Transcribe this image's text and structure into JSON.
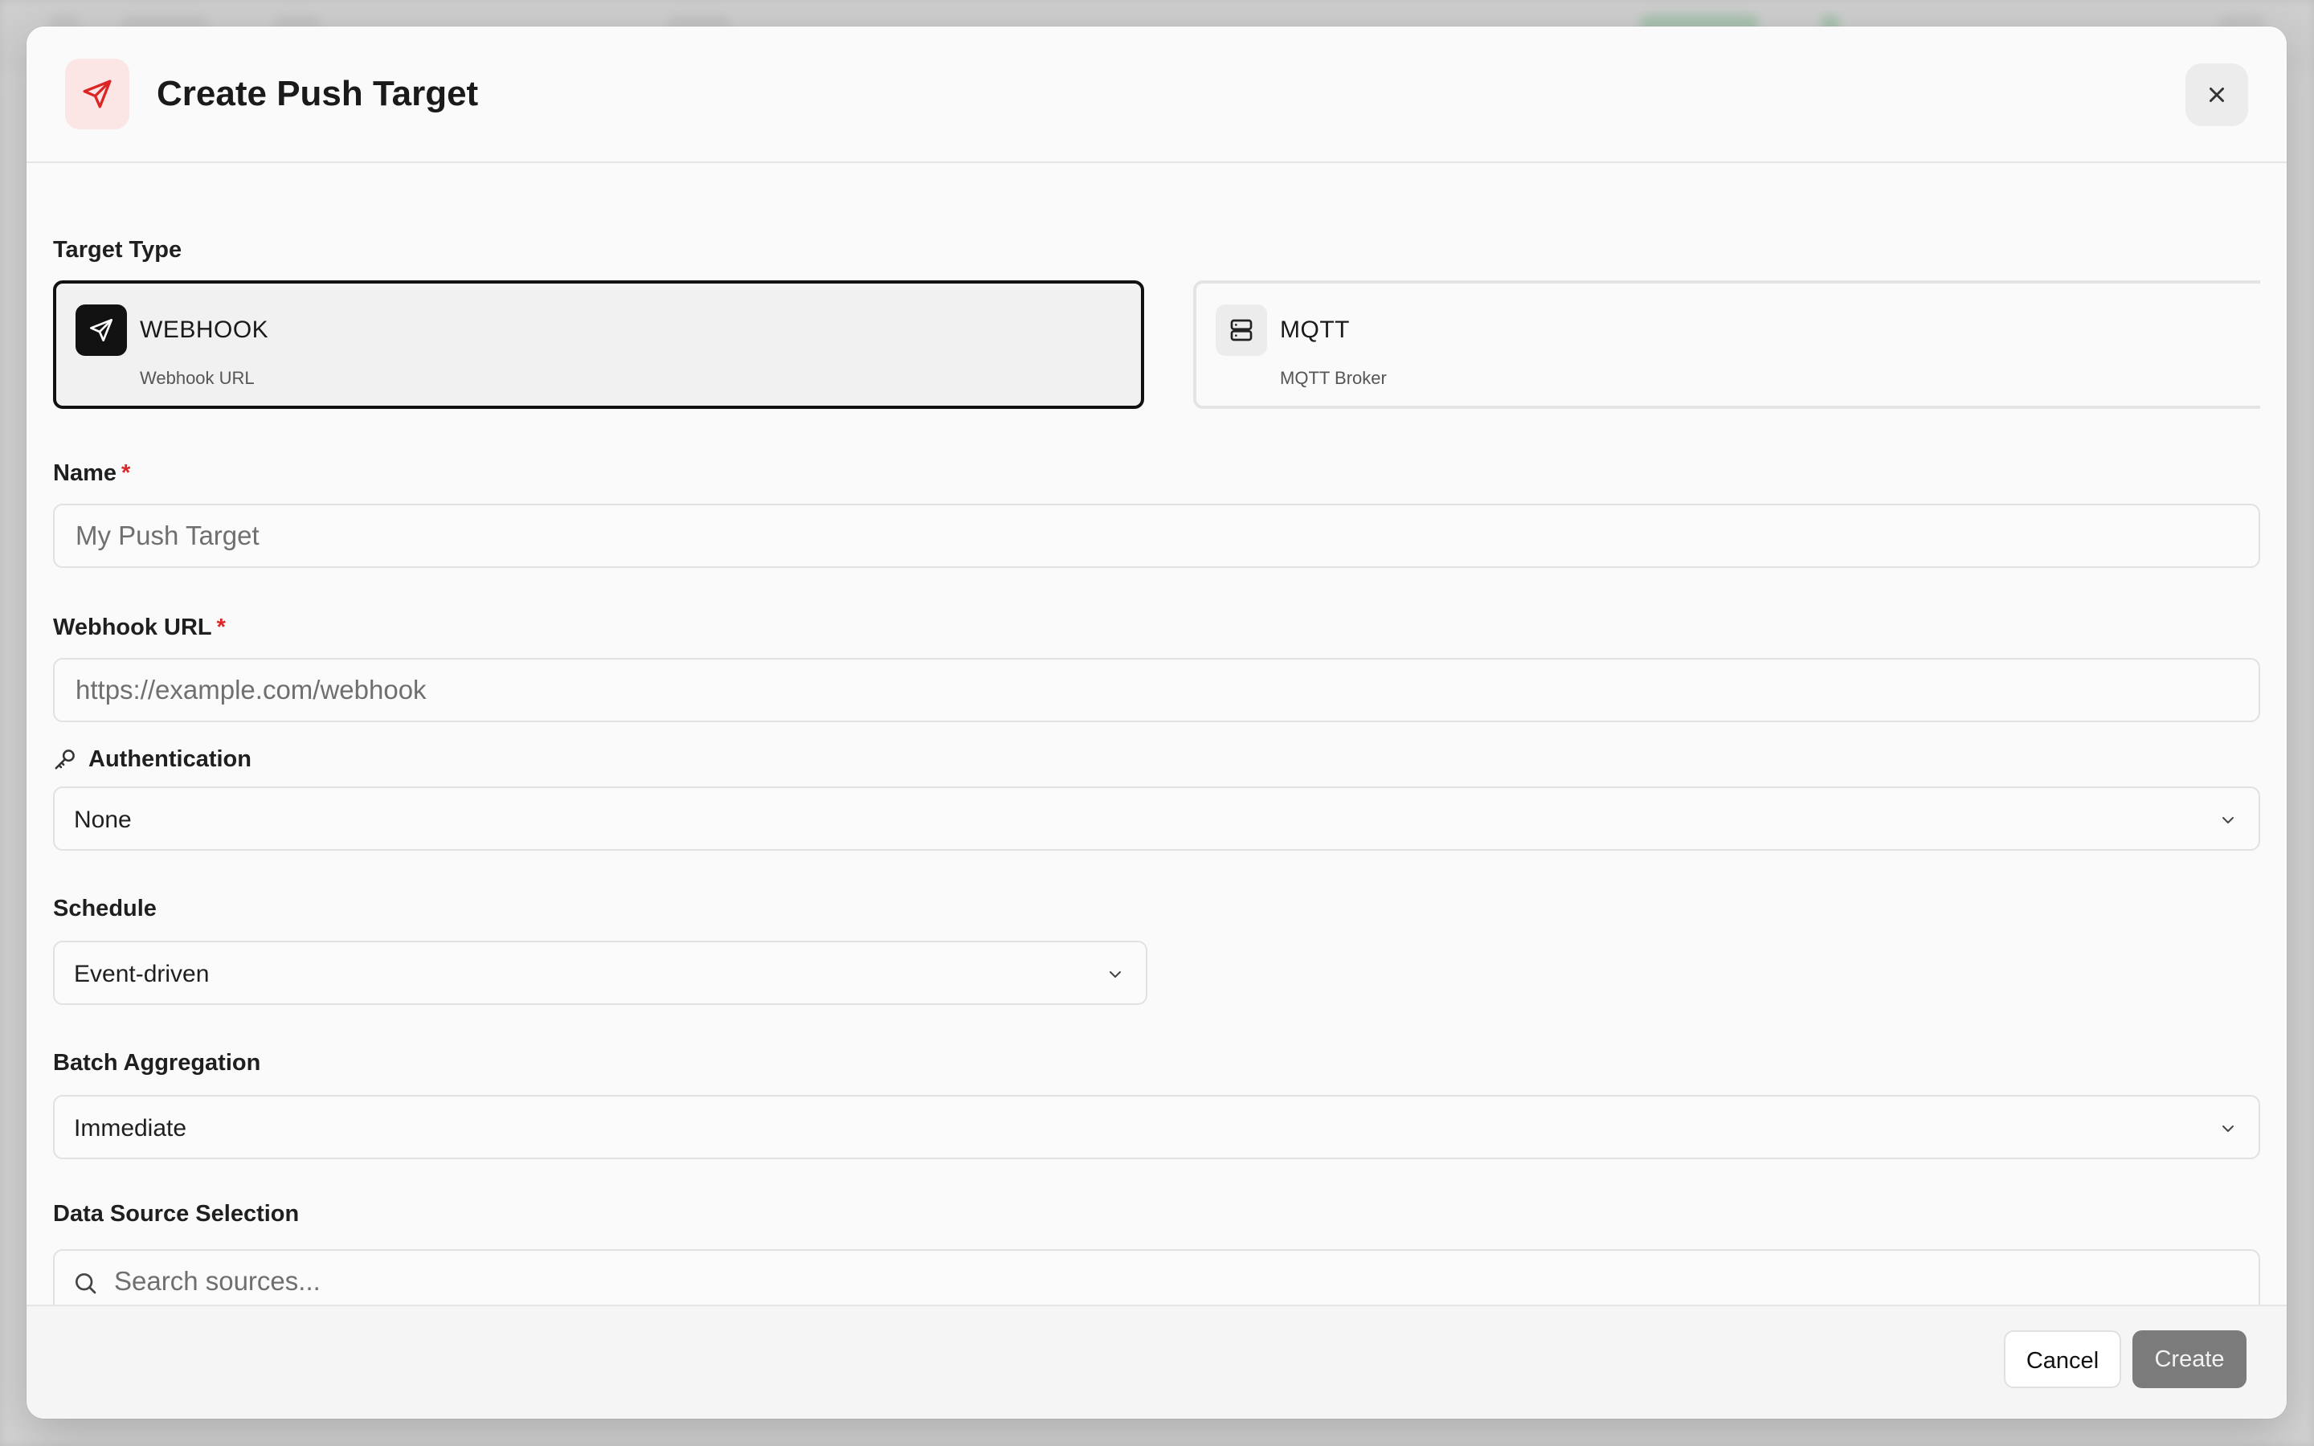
{
  "dialog": {
    "title": "Create Push Target",
    "header_icon": "send-icon",
    "close_icon": "close-icon"
  },
  "target_type": {
    "label": "Target Type",
    "selected": "WEBHOOK",
    "options": [
      {
        "title": "WEBHOOK",
        "subtitle": "Webhook URL",
        "icon": "send-icon"
      },
      {
        "title": "MQTT",
        "subtitle": "MQTT Broker",
        "icon": "server-icon"
      }
    ]
  },
  "name": {
    "label": "Name",
    "required_mark": "*",
    "placeholder": "My Push Target",
    "value": ""
  },
  "webhook_url": {
    "label": "Webhook URL",
    "required_mark": "*",
    "placeholder": "https://example.com/webhook",
    "value": ""
  },
  "authentication": {
    "label": "Authentication",
    "icon": "key-icon",
    "value": "None"
  },
  "schedule": {
    "label": "Schedule",
    "value": "Event-driven"
  },
  "batch_aggregation": {
    "label": "Batch Aggregation",
    "value": "Immediate"
  },
  "data_source": {
    "label": "Data Source Selection",
    "search_placeholder": "Search sources..."
  },
  "footer": {
    "cancel_label": "Cancel",
    "create_label": "Create"
  },
  "colors": {
    "accent_red": "#dc2626",
    "selected_border": "#111111",
    "create_disabled": "#7b7b7b"
  }
}
